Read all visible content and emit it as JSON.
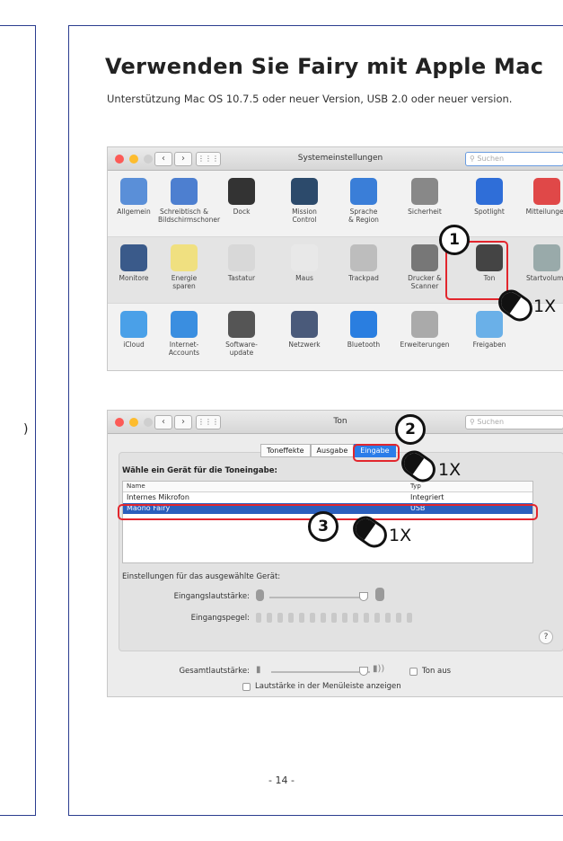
{
  "title": "Verwenden Sie Fairy mit Apple Mac",
  "subtitle": "Unterstützung Mac OS 10.7.5 oder neuer Version, USB 2.0 oder neuer version.",
  "left_fragment": ")",
  "page_number": "- 14 -",
  "accent_color": "#2b3d8f",
  "highlight_color": "#e2262d",
  "window1": {
    "title": "Systemeinstellungen",
    "search_placeholder": "Suchen",
    "rows": [
      [
        "Allgemein",
        "Schreibtisch &\nBildschirmschoner",
        "Dock",
        "Mission\nControl",
        "Sprache\n& Region",
        "Sicherheit",
        "Spotlight",
        "Mitteilungen"
      ],
      [
        "Monitore",
        "Energie\nsparen",
        "Tastatur",
        "Maus",
        "Trackpad",
        "Drucker &\nScanner",
        "Ton",
        "Startvolume"
      ],
      [
        "iCloud",
        "Internet-\nAccounts",
        "Software-\nupdate",
        "Netzwerk",
        "Bluetooth",
        "Erweiterungen",
        "Freigaben"
      ]
    ]
  },
  "window2": {
    "title": "Ton",
    "search_placeholder": "Suchen",
    "tabs": [
      "Toneffekte",
      "Ausgabe",
      "Eingabe"
    ],
    "panel_title": "Wähle ein Gerät für die Toneingabe:",
    "col_name": "Name",
    "col_type": "Typ",
    "devices": [
      {
        "name": "Internes Mikrofon",
        "type": "Integriert"
      },
      {
        "name": "Maono Fairy",
        "type": "USB"
      }
    ],
    "settings_label": "Einstellungen für das ausgewählte Gerät:",
    "input_volume_label": "Eingangslautstärke:",
    "input_level_label": "Eingangspegel:",
    "output_volume_label": "Gesamtlautstärke:",
    "mute_label": "Ton aus",
    "menubar_label": "Lautstärke in der Menüleiste anzeigen",
    "help": "?"
  },
  "steps": [
    {
      "number": "1",
      "clicks": "1X"
    },
    {
      "number": "2",
      "clicks": "1X"
    },
    {
      "number": "3",
      "clicks": "1X"
    }
  ]
}
